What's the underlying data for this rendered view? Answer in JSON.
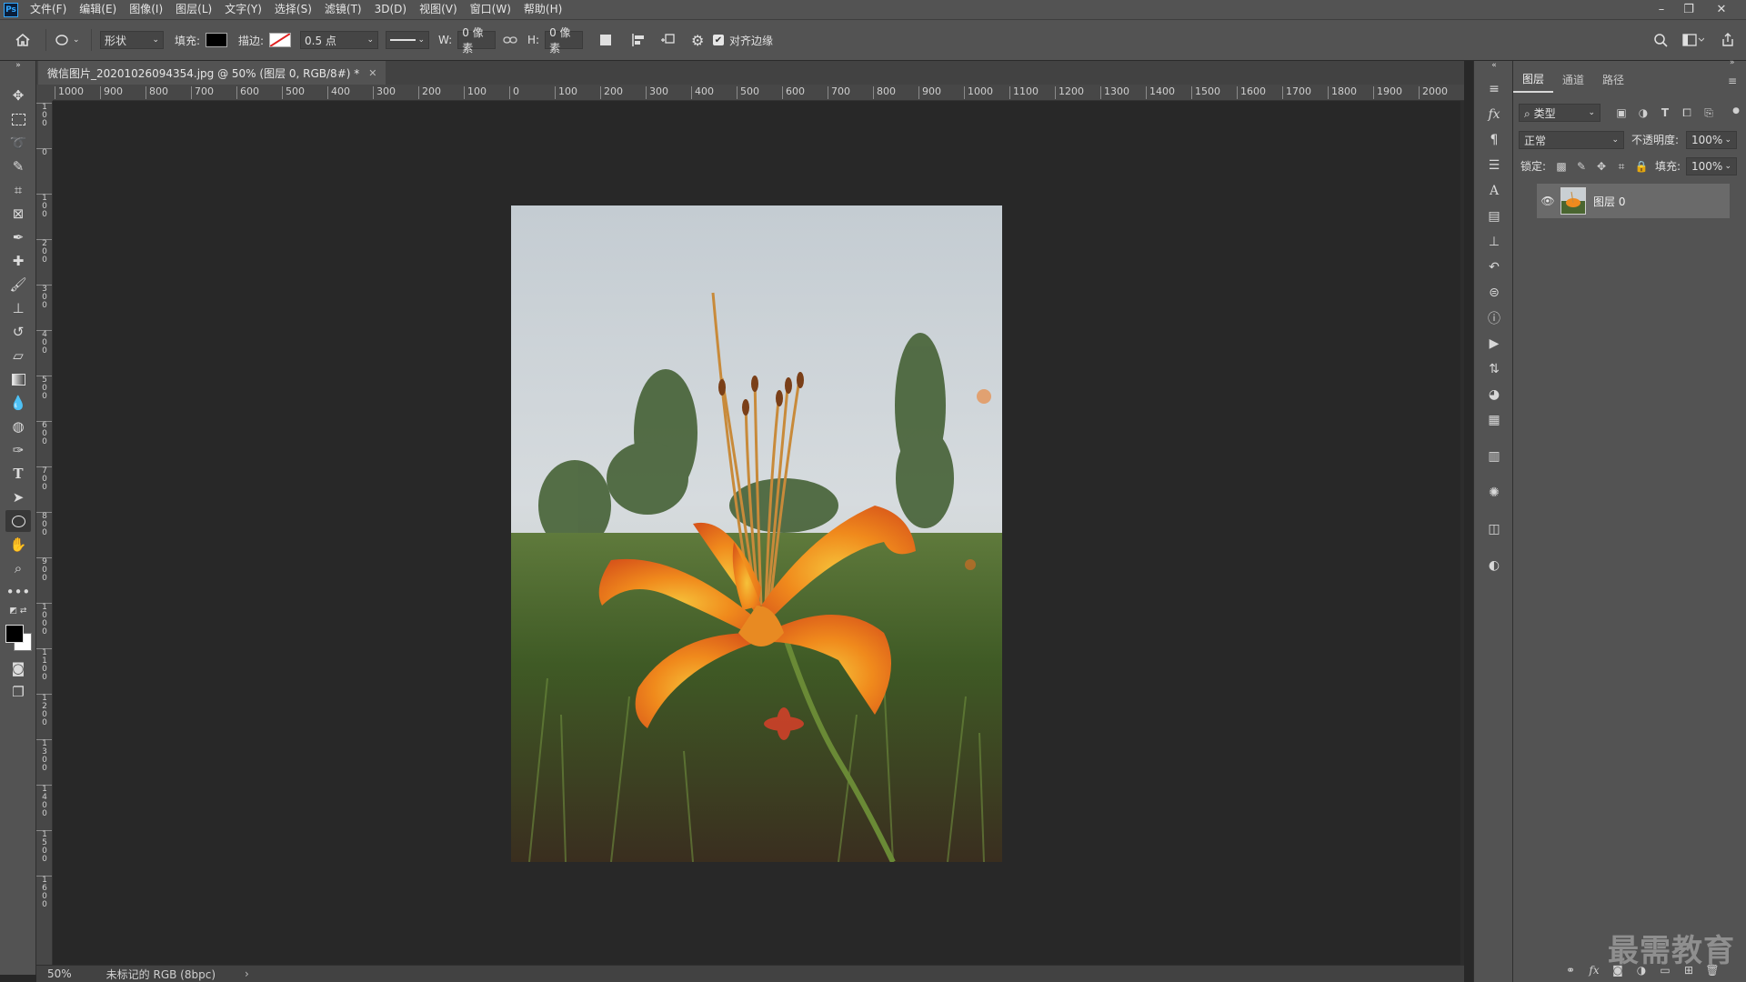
{
  "app": {
    "logo_text": "Ps",
    "menu": [
      "文件(F)",
      "编辑(E)",
      "图像(I)",
      "图层(L)",
      "文字(Y)",
      "选择(S)",
      "滤镜(T)",
      "3D(D)",
      "视图(V)",
      "窗口(W)",
      "帮助(H)"
    ]
  },
  "window_controls": {
    "minimize": "–",
    "restore": "❐",
    "close": "✕"
  },
  "options_bar": {
    "mode": "形状",
    "fill_label": "填充:",
    "stroke_label": "描边:",
    "stroke_width": "0.5 点",
    "w_label": "W:",
    "w_value": "0 像素",
    "h_label": "H:",
    "h_value": "0 像素",
    "align_edges_label": "对齐边缘",
    "align_edges_checked": true
  },
  "document": {
    "tab_title": "微信图片_20201026094354.jpg @ 50% (图层 0, RGB/8#) *",
    "zoom": "50%",
    "color_profile": "未标记的 RGB (8bpc)"
  },
  "ruler": {
    "h_ticks": [
      "1000",
      "900",
      "800",
      "700",
      "600",
      "500",
      "400",
      "300",
      "200",
      "100",
      "0",
      "100",
      "200",
      "300",
      "400",
      "500",
      "600",
      "700",
      "800",
      "900",
      "1000",
      "1100",
      "1200",
      "1300",
      "1400",
      "1500",
      "1600",
      "1700",
      "1800",
      "1900",
      "2000"
    ],
    "v_ticks": [
      "100",
      "0",
      "100",
      "200",
      "300",
      "400",
      "500",
      "600",
      "700",
      "800",
      "900",
      "1000",
      "1100",
      "1200",
      "1300",
      "1400",
      "1500",
      "1600"
    ]
  },
  "layers_panel": {
    "tabs": [
      "图层",
      "通道",
      "路径"
    ],
    "active_tab": 0,
    "filter_kind": "类型",
    "blend_mode": "正常",
    "opacity_label": "不透明度:",
    "opacity_value": "100%",
    "lock_label": "锁定:",
    "fill_label": "填充:",
    "fill_value": "100%",
    "layers": [
      {
        "name": "图层 0",
        "visible": true
      }
    ]
  },
  "watermark": "最需教育",
  "colors": {
    "ui_bg": "#535353",
    "workspace": "#282828",
    "accent": "#31a8ff"
  }
}
